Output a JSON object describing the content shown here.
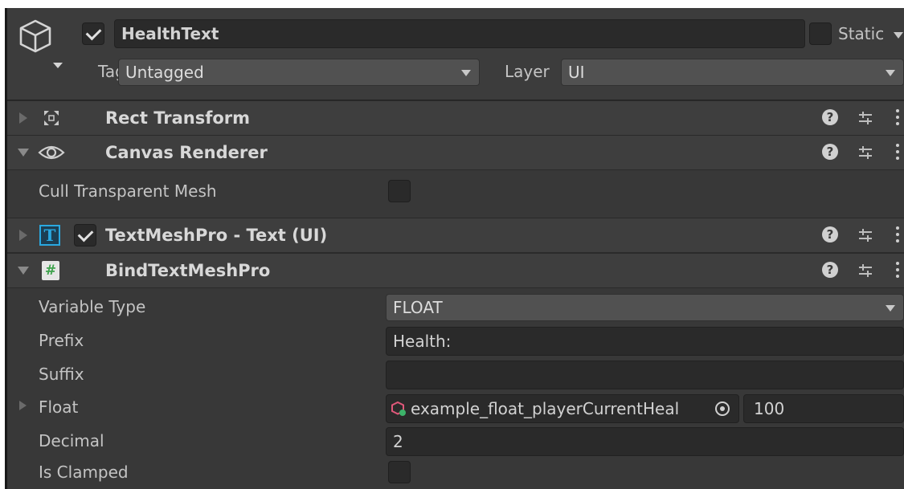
{
  "object_header": {
    "name": "HealthText",
    "active": true,
    "static_label": "Static",
    "static_checked": false,
    "tag_label": "Tag",
    "tag_value": "Untagged",
    "layer_label": "Layer",
    "layer_value": "UI"
  },
  "components": {
    "rect_transform": {
      "title": "Rect Transform",
      "expanded": false
    },
    "canvas_renderer": {
      "title": "Canvas Renderer",
      "expanded": true,
      "cull_label": "Cull Transparent Mesh",
      "cull_checked": false
    },
    "textmeshpro": {
      "title": "TextMeshPro - Text (UI)",
      "enabled": true,
      "expanded": false,
      "icon_letter": "T"
    },
    "bind": {
      "title": "BindTextMeshPro",
      "expanded": true,
      "icon_letter": "#",
      "fields": {
        "variable_type_label": "Variable Type",
        "variable_type_value": "FLOAT",
        "prefix_label": "Prefix",
        "prefix_value": "Health:",
        "suffix_label": "Suffix",
        "suffix_value": "",
        "float_label": "Float",
        "float_ref": "example_float_playerCurrentHeal",
        "float_value": "100",
        "decimal_label": "Decimal",
        "decimal_value": "2",
        "clamped_label": "Is Clamped",
        "clamped_checked": false
      }
    }
  },
  "icons": {
    "gameobject": "cube-icon",
    "rect": "rect-transform-icon",
    "eye": "eye-icon",
    "tmp": "tmp-text-icon",
    "script": "csharp-script-icon",
    "help": "help-icon",
    "presets": "presets-icon",
    "menu": "kebab-menu-icon",
    "target": "object-picker-icon"
  },
  "colors": {
    "panel_bg": "#383838",
    "header_bg": "#3e3e3e",
    "field_bg": "#2a2a2a",
    "tmp_accent": "#2aa8e0",
    "script_accent": "#3fa34d"
  }
}
